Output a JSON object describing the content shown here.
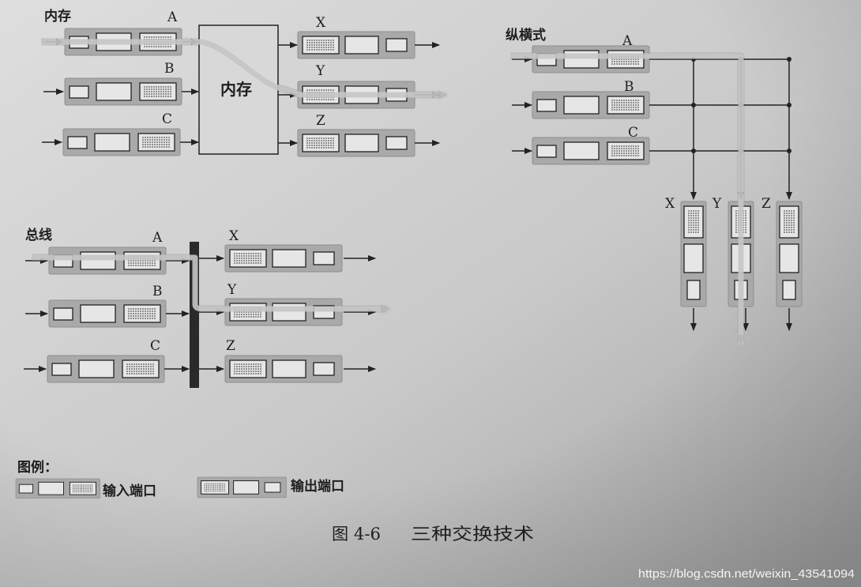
{
  "memory": {
    "label": "内存",
    "box_label": "内存",
    "inputs": [
      "A",
      "B",
      "C"
    ],
    "outputs": [
      "X",
      "Y",
      "Z"
    ]
  },
  "bus": {
    "label": "总线",
    "inputs": [
      "A",
      "B",
      "C"
    ],
    "outputs": [
      "X",
      "Y",
      "Z"
    ]
  },
  "crossbar": {
    "label": "纵横式",
    "inputs": [
      "A",
      "B",
      "C"
    ],
    "outputs": [
      "X",
      "Y",
      "Z"
    ]
  },
  "legend": {
    "title": "图例：",
    "input_port": "输入端口",
    "output_port": "输出端口"
  },
  "figure": {
    "number": "图 4-6",
    "title": "三种交换技术"
  },
  "watermark": "https://blog.csdn.net/weixin_43541094",
  "colors": {
    "port_band": "#a9a9a9",
    "cell_fill": "#e6e6e6",
    "ink": "#222222",
    "highlight": "#c6c6c6",
    "watermark": "#f4f4f4"
  }
}
